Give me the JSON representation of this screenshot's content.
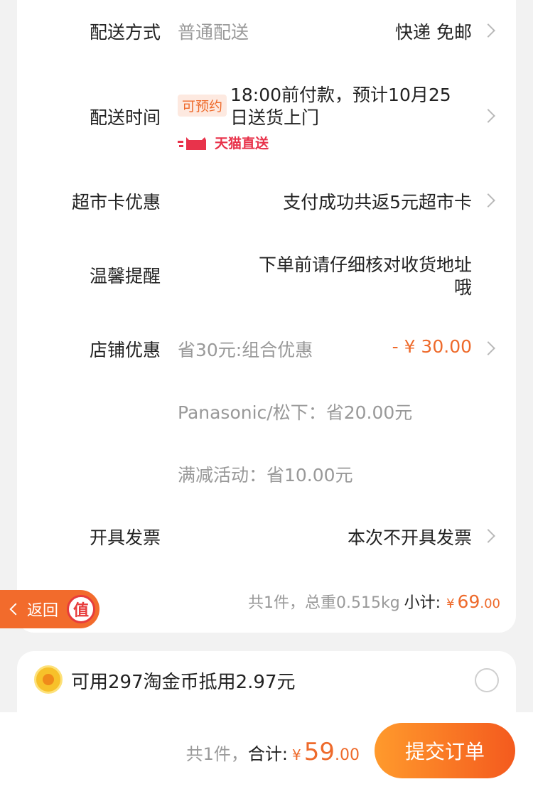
{
  "delivery": {
    "label": "配送方式",
    "value": "普通配送",
    "detail": "快递 免邮"
  },
  "delivery_time": {
    "label": "配送时间",
    "tag": "可预约",
    "line1": "18:00前付款，预计10月25",
    "line2": "日送货上门",
    "tmall_text": "天猫直送"
  },
  "supermarket_card": {
    "label": "超市卡优惠",
    "value": "支付成功共返5元超市卡"
  },
  "reminder": {
    "label": "温馨提醒",
    "line1": "下单前请仔细核对收货地址",
    "line2": "哦"
  },
  "store_discount": {
    "label": "店铺优惠",
    "value": "省30元:组合优惠",
    "amount": "- ¥ 30.00",
    "sub1": "Panasonic/松下：省20.00元",
    "sub2": "满减活动：省10.00元"
  },
  "invoice": {
    "label": "开具发票",
    "value": "本次不开具发票"
  },
  "subtotal": {
    "summary": "共1件，总重0.515kg",
    "label": "小计:",
    "currency": "¥",
    "integer": "69",
    "decimal": ".00"
  },
  "back_button": {
    "label": "返回",
    "badge": "值"
  },
  "coins": {
    "text": "可用297淘金币抵用2.97元"
  },
  "footer": {
    "count": "共1件，",
    "total_label": "合计:",
    "currency": "¥",
    "integer": "59",
    "decimal": ".00",
    "submit_label": "提交订单"
  },
  "colors": {
    "accent": "#ee6a2b",
    "tmall": "#e8334b",
    "button_start": "#ff9a2c",
    "button_end": "#f45a1e"
  }
}
